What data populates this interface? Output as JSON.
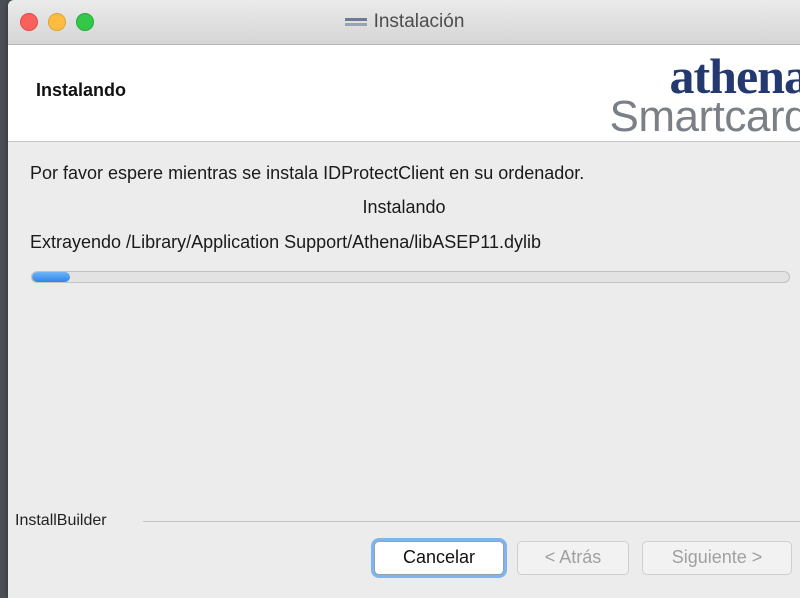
{
  "window": {
    "title": "Instalación",
    "title_icon": "athena-app-icon"
  },
  "header": {
    "title": "Instalando",
    "logo_top": "athena",
    "logo_bottom": "Smartcard",
    "logo_color": "#23396f"
  },
  "content": {
    "message": "Por favor espere mientras se instala IDProtectClient en su ordenador.",
    "status": "Instalando",
    "detail": "Extrayendo /Library/Application Support/Athena/libASEP11.dylib",
    "progress": 0.05
  },
  "footer": {
    "group_label": "InstallBuilder",
    "cancel_label": "Cancelar",
    "back_label": "< Atrás",
    "next_label": "Siguiente >"
  },
  "colors": {
    "progress_fill": "#3b8ef0",
    "focus_ring": "#7eb5f0"
  }
}
